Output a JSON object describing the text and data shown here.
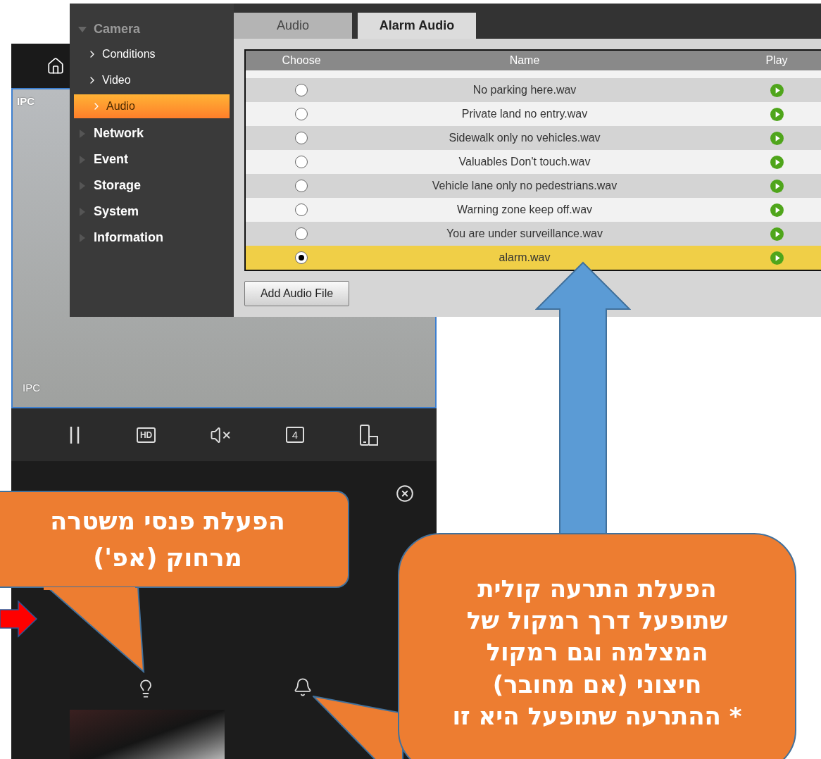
{
  "live_view": {
    "channel_labels": [
      "IPC",
      "IPC"
    ],
    "toolbar": {
      "hd_label": "HD",
      "split_label": "4"
    }
  },
  "settings_window": {
    "sidebar": {
      "items": [
        {
          "label": "Camera",
          "expanded": true,
          "children": [
            {
              "label": "Conditions",
              "selected": false
            },
            {
              "label": "Video",
              "selected": false
            },
            {
              "label": "Audio",
              "selected": true
            }
          ]
        },
        {
          "label": "Network",
          "expanded": false
        },
        {
          "label": "Event",
          "expanded": false
        },
        {
          "label": "Storage",
          "expanded": false
        },
        {
          "label": "System",
          "expanded": false
        },
        {
          "label": "Information",
          "expanded": false
        }
      ]
    },
    "tabs": [
      {
        "label": "Audio",
        "selected": false
      },
      {
        "label": "Alarm Audio",
        "selected": true
      }
    ],
    "table": {
      "columns": [
        "Choose",
        "Name",
        "Play"
      ],
      "rows": [
        {
          "name": "No parking here.wav",
          "selected": false
        },
        {
          "name": "Private land no entry.wav",
          "selected": false
        },
        {
          "name": "Sidewalk only no vehicles.wav",
          "selected": false
        },
        {
          "name": "Valuables Don't touch.wav",
          "selected": false
        },
        {
          "name": "Vehicle lane only no pedestrians.wav",
          "selected": false
        },
        {
          "name": "Warning zone keep off.wav",
          "selected": false
        },
        {
          "name": "You are under surveillance.wav",
          "selected": false
        },
        {
          "name": "alarm.wav",
          "selected": true
        }
      ]
    },
    "add_button": "Add Audio File"
  },
  "callouts": [
    {
      "text": "הפעלת פנסי משטרה\nמרחוק (אפ')"
    },
    {
      "text": "הפעלת התרעה קולית\nשתופעל דרך רמקול של\nהמצלמה וגם רמקול\nחיצוני (אם מחובר)\n* ההתרעה שתופעל היא זו"
    }
  ]
}
